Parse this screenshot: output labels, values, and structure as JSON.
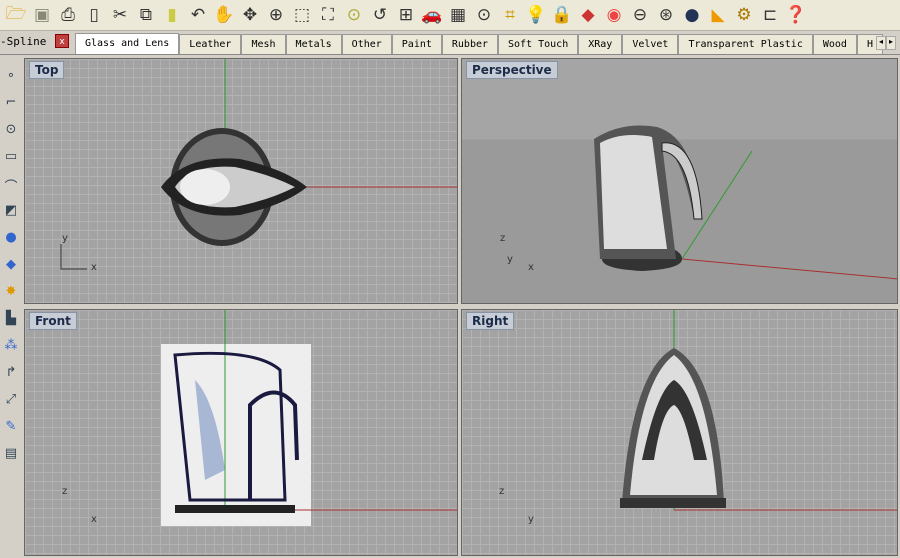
{
  "toolbar": {
    "icons": [
      "open-folder",
      "save",
      "print",
      "document-properties",
      "cut",
      "copy",
      "paste",
      "undo",
      "pan-hand",
      "rotate-view",
      "zoom-in",
      "zoom-window",
      "zoom-extents",
      "zoom-selected",
      "undo-view",
      "four-viewports",
      "car-render",
      "grid-snap",
      "point",
      "osnap",
      "light-bulb",
      "lock",
      "layers",
      "color-wheel",
      "sphere-wireframe",
      "sphere-mesh",
      "render-sphere",
      "render-cone",
      "settings-gear",
      "hierarchy",
      "help"
    ]
  },
  "tabbar": {
    "left_label": "-Spline",
    "tabs": [
      "Glass and Lens",
      "Leather",
      "Mesh",
      "Metals",
      "Other",
      "Paint",
      "Rubber",
      "Soft Touch",
      "XRay",
      "Velvet",
      "Transparent Plastic",
      "Wood",
      "H"
    ],
    "active": "Glass and Lens"
  },
  "viewports": {
    "top": {
      "label": "Top",
      "axis_x": "x",
      "axis_y": "y"
    },
    "perspective": {
      "label": "Perspective",
      "axis_x": "x",
      "axis_y": "y",
      "axis_z": "z"
    },
    "front": {
      "label": "Front",
      "axis_x": "x",
      "axis_z": "z"
    },
    "right": {
      "label": "Right",
      "axis_y": "y",
      "axis_z": "z"
    }
  },
  "colors": {
    "x_axis": "#b03030",
    "y_axis": "#30a030",
    "grid": "#a3a3a3"
  }
}
